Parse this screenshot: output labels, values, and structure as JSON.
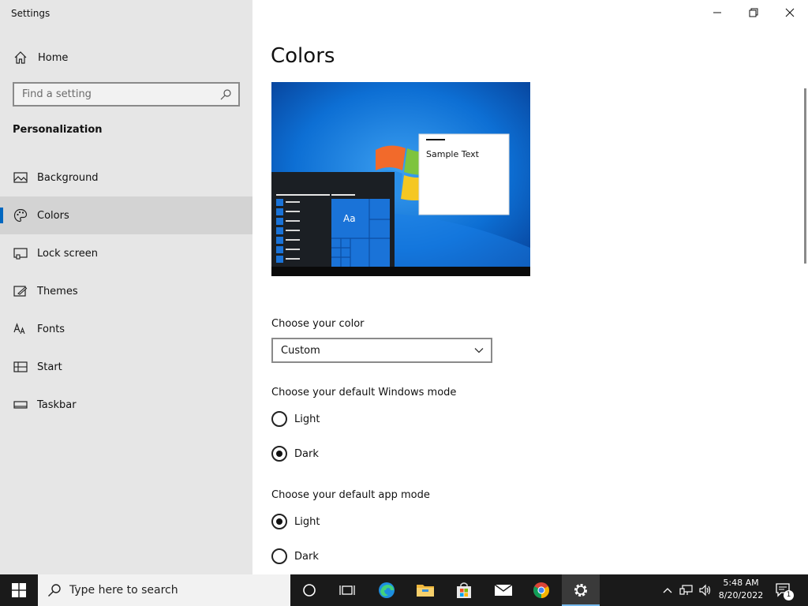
{
  "window": {
    "app_title": "Settings"
  },
  "sidebar": {
    "home_label": "Home",
    "search_placeholder": "Find a setting",
    "section_title": "Personalization",
    "items": [
      {
        "label": "Background",
        "icon": "picture-icon"
      },
      {
        "label": "Colors",
        "icon": "palette-icon",
        "selected": true
      },
      {
        "label": "Lock screen",
        "icon": "lock-screen-icon"
      },
      {
        "label": "Themes",
        "icon": "brush-icon"
      },
      {
        "label": "Fonts",
        "icon": "font-icon"
      },
      {
        "label": "Start",
        "icon": "start-icon"
      },
      {
        "label": "Taskbar",
        "icon": "taskbar-icon"
      }
    ]
  },
  "main": {
    "title": "Colors",
    "preview": {
      "sample_text": "Sample Text",
      "tile_text": "Aa"
    },
    "choose_color": {
      "label": "Choose your color",
      "selected": "Custom"
    },
    "windows_mode": {
      "label": "Choose your default Windows mode",
      "options": [
        "Light",
        "Dark"
      ],
      "selected": "Dark"
    },
    "app_mode": {
      "label": "Choose your default app mode",
      "options": [
        "Light",
        "Dark"
      ],
      "selected": "Light"
    }
  },
  "taskbar": {
    "search_placeholder": "Type here to search",
    "time": "5:48 AM",
    "date": "8/20/2022",
    "notification_count": "1"
  },
  "colors": {
    "accent": "#0067c0",
    "sidebar_bg": "#e6e6e6",
    "taskbar_bg": "#1a1a1a"
  }
}
